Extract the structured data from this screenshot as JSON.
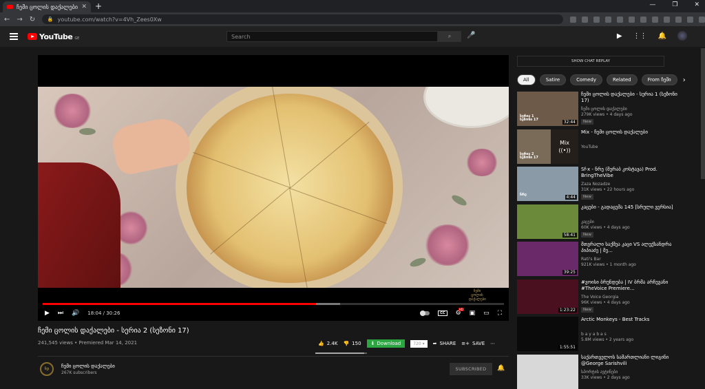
{
  "browser": {
    "tab_title": "ჩემი ცოლის დაქალები - ს",
    "url": "youtube.com/watch?v=4Vh_Zees0Xw"
  },
  "header": {
    "logo": "YouTube",
    "country_code": "GE",
    "search_placeholder": "Search"
  },
  "player": {
    "current_time": "18:04",
    "duration": "30:26",
    "time_display": "18:04 / 30:26",
    "progress_fraction": 0.593,
    "buffer_fraction": 0.645,
    "watermark": "ჩემი ცოლის დაქალები"
  },
  "video": {
    "title": "ჩემი ცოლის დაქალები - სერია 2 (სეზონი 17)",
    "meta": "241,545 views • Premiered Mar 14, 2021",
    "likes": "2.4K",
    "dislikes": "150",
    "like_ratio": 0.94,
    "download_label": "Download",
    "quality": "720",
    "share_label": "SHARE",
    "save_label": "SAVE"
  },
  "channel": {
    "name": "ჩემი ცოლის დაქალები",
    "subscribers": "267K subscribers",
    "avatar_text": "ჩდ",
    "subscribe_label": "SUBSCRIBED"
  },
  "sidebar": {
    "chat_replay": "SHOW CHAT REPLAY",
    "chips": [
      "All",
      "Satire",
      "Comedy",
      "Related",
      "From ჩემი"
    ],
    "items": [
      {
        "title": "ჩემი ცოლის დაქალები - სერია 1 (სეზონი 17)",
        "channel": "ჩემი ცოლის დაქალები",
        "meta": "279K views • 4 days ago",
        "badge": "New",
        "duration": "32:44",
        "cap": "სერია 1\nსეზონი 17",
        "thumb_color": "#6e5a48"
      },
      {
        "title": "Mix - ჩემი ცოლის დაქალები",
        "channel": "YouTube",
        "meta": "",
        "badge": "",
        "duration": "",
        "mix": "Mix",
        "cap": "სერია 2\nსეზონი 17",
        "thumb_color": "#7a6a58"
      },
      {
        "title": "Sf-x - ნრე (მერაბ კოსტავა) Prod. BringTheVibe",
        "channel": "Zaza Nozadze",
        "meta": "31K views • 22 hours ago",
        "badge": "New",
        "duration": "4:44",
        "cap": "ნრე",
        "thumb_color": "#8a9aa6"
      },
      {
        "title": "კაცები - გადაცემა 145 [სრული ვერსია]",
        "channel": "კაცები",
        "meta": "60K views • 4 days ago",
        "badge": "New",
        "duration": "58:41",
        "thumb_color": "#6b8a3a"
      },
      {
        "title": "მთვრალი საქმეა კაცი VS ალექსანდრა პიპიაძე | მე...",
        "channel": "Rati's Bar",
        "meta": "921K views • 1 month ago",
        "badge": "",
        "duration": "39:25",
        "thumb_color": "#6a2a6a"
      },
      {
        "title": "#ვოისი ბრუნდება | IV ბრმა არჩევანი #TheVoice Premiere...",
        "channel": "The Voice Georgia",
        "meta": "96K views • 4 days ago",
        "badge": "New",
        "duration": "1:23:22",
        "thumb_color": "#4a1020"
      },
      {
        "title": "Arctic Monkeys - Best Tracks",
        "channel": "b a y a b a s",
        "meta": "5.8M views • 2 years ago",
        "badge": "",
        "duration": "1:55:51",
        "thumb_color": "#0a0a0a"
      },
      {
        "title": "საქართველოს სამართლიანი ლიგინი @George Sarishvili",
        "channel": "სპორტის ავტინები",
        "meta": "33K views • 2 days ago",
        "badge": "",
        "duration": "",
        "thumb_color": "#d8d8d8"
      }
    ]
  },
  "colors": {
    "accent": "#ff0000",
    "download": "#2ba640",
    "background": "#181818"
  }
}
